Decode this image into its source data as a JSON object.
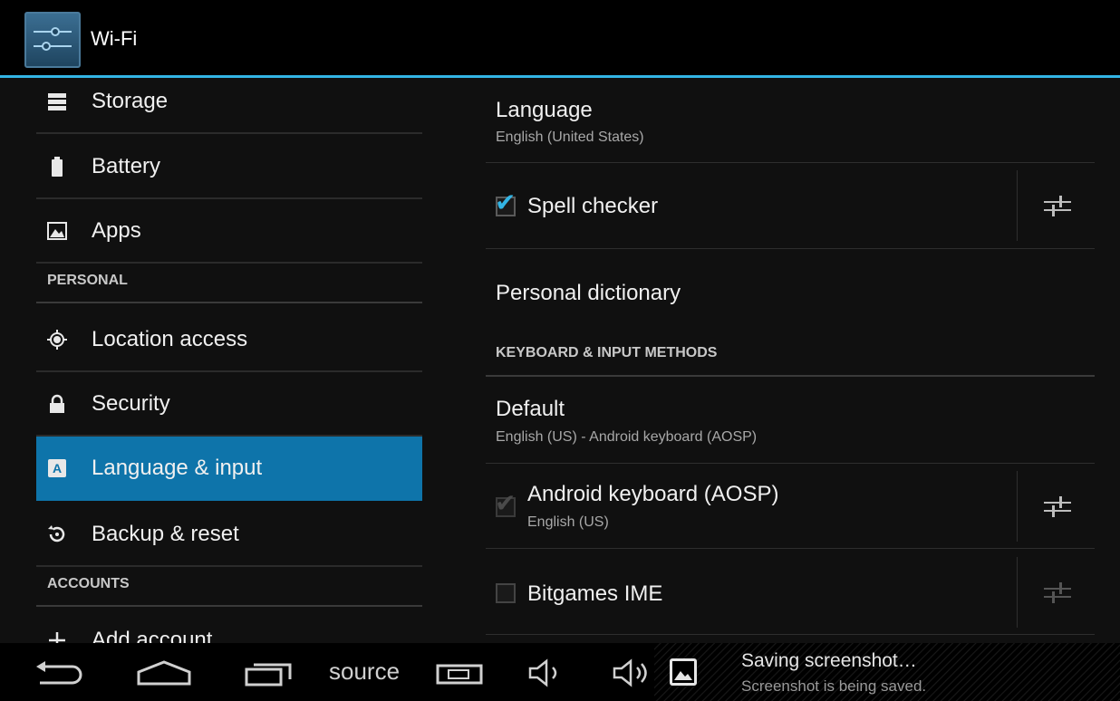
{
  "app_bar": {
    "title": "Wi-Fi",
    "accent": "#33b5e5"
  },
  "sidebar": {
    "items": [
      {
        "label": "Storage",
        "icon": "storage-icon"
      },
      {
        "label": "Battery",
        "icon": "battery-icon"
      },
      {
        "label": "Apps",
        "icon": "apps-icon"
      }
    ],
    "personal_header": "PERSONAL",
    "personal_items": [
      {
        "label": "Location access",
        "icon": "location-icon"
      },
      {
        "label": "Security",
        "icon": "lock-icon"
      },
      {
        "label": "Language & input",
        "icon": "language-icon",
        "active": true
      },
      {
        "label": "Backup & reset",
        "icon": "backup-icon"
      }
    ],
    "accounts_header": "ACCOUNTS",
    "accounts_items": [
      {
        "label": "Add account",
        "icon": "add-icon"
      }
    ],
    "active_color": "#0e74aa"
  },
  "main": {
    "language": {
      "title": "Language",
      "summary": "English (United States)"
    },
    "spell_checker": {
      "title": "Spell checker",
      "checked": true
    },
    "personal_dictionary": {
      "title": "Personal dictionary"
    },
    "keyboard_section": "KEYBOARD & INPUT METHODS",
    "default": {
      "title": "Default",
      "summary": "English (US) - Android keyboard (AOSP)"
    },
    "android_keyboard": {
      "title": "Android keyboard (AOSP)",
      "summary": "English (US)",
      "checked": true,
      "disabled": true
    },
    "bitgames": {
      "title": "Bitgames IME",
      "checked": false
    }
  },
  "navbar": {
    "source_label": "source",
    "icons": [
      "back-icon",
      "home-icon",
      "recents-icon",
      "camera-icon",
      "volume-down-icon",
      "volume-up-icon"
    ]
  },
  "notification": {
    "title": "Saving screenshot…",
    "subtitle": "Screenshot is being saved.",
    "icon": "picture-icon"
  }
}
